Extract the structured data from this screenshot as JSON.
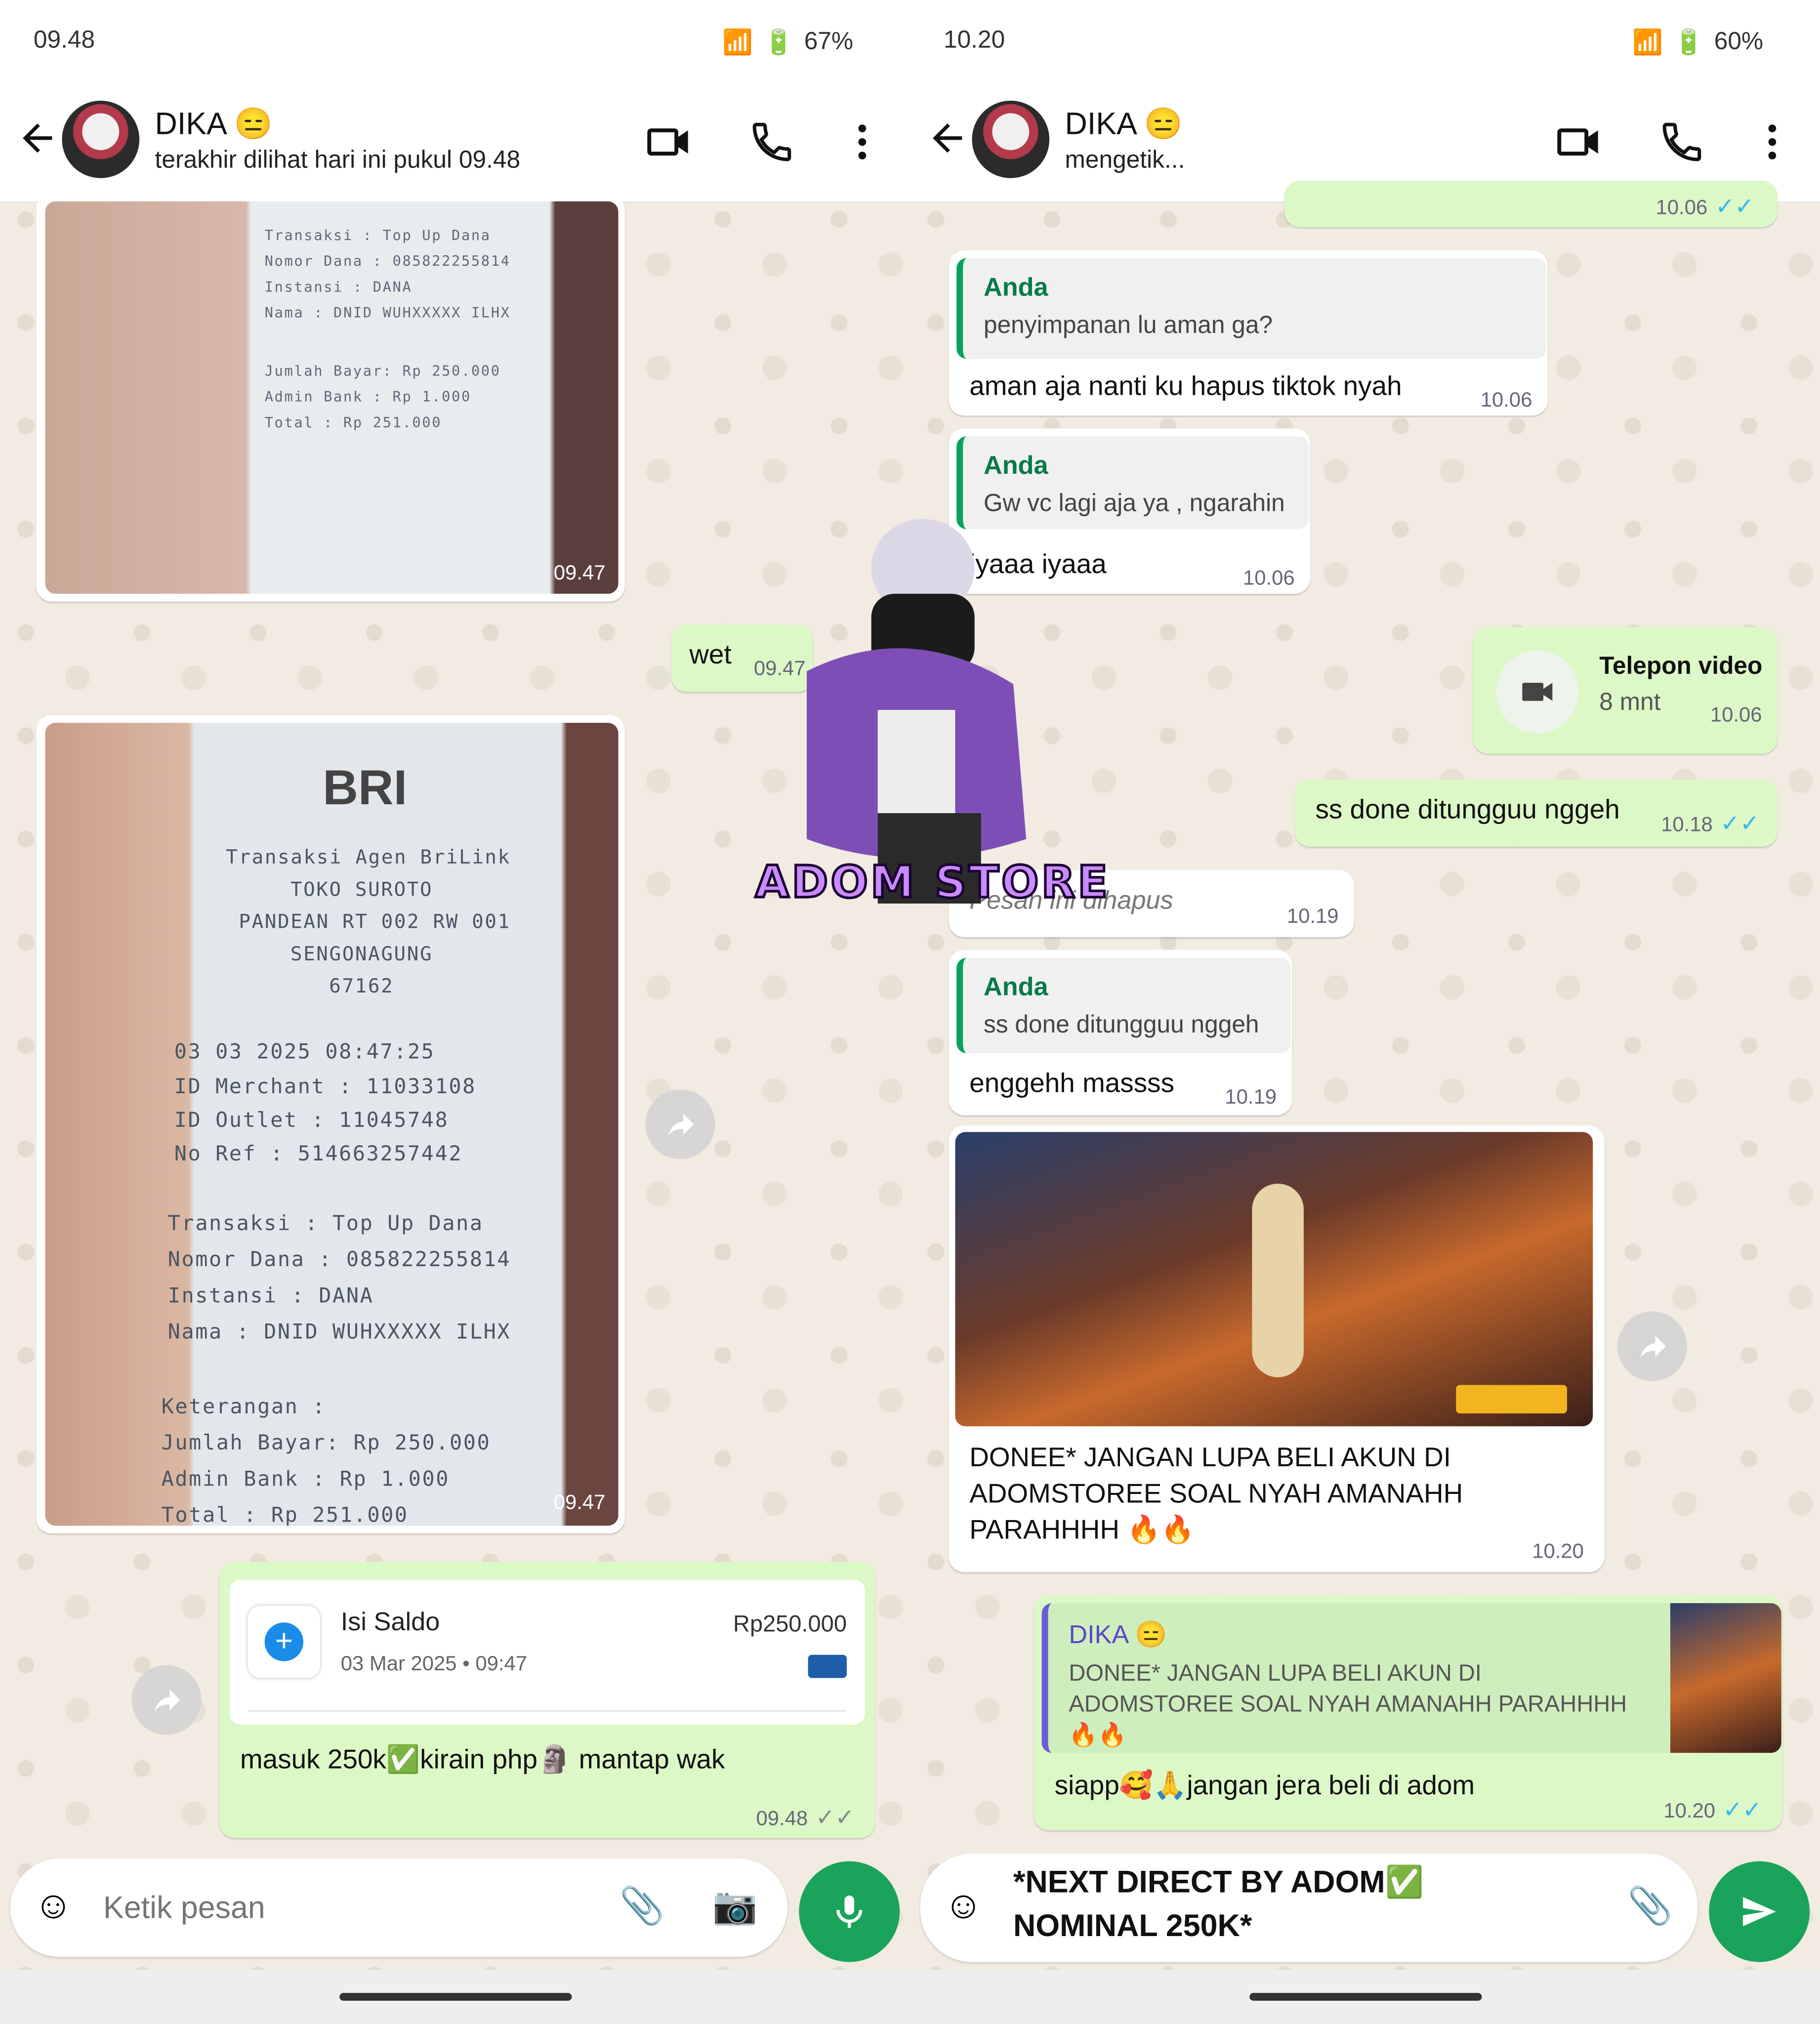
{
  "left": {
    "status_time": "09.48",
    "status_right": "67%",
    "contact_name": "DIKA 😑",
    "last_seen": "terakhir dilihat hari ini pukul 09.48",
    "photo1_time": "09.47",
    "wet_text": "wet",
    "wet_time": "09.47",
    "photo2_time": "09.47",
    "receipt_bank": "BRI",
    "receipt_lines": [
      "Transaksi Agen BriLink",
      "TOKO SUROTO",
      "PANDEAN RT 002 RW 001",
      "SENGONAGUNG",
      "67162",
      "03 03 2025 08:47:25",
      "ID Merchant : 11033108",
      "ID Outlet   : 11045748",
      "No Ref      : 514663257442",
      "Transaksi   : Top Up Dana",
      "Nomor Dana  : 085822255814",
      "Instansi    : DANA",
      "Nama        : DNID WUHXXXXX ILHX",
      "Keterangan  :",
      "Jumlah Bayar: Rp 250.000",
      "Admin Bank  : Rp 1.000",
      "Total       : Rp 251.000"
    ],
    "card_title": "Isi Saldo",
    "card_date": "03 Mar 2025 • 09:47",
    "card_amount": "Rp250.000",
    "last_text": "masuk 250k✅kirain php🗿 mantap wak",
    "last_time": "09.48",
    "input_placeholder": "Ketik pesan"
  },
  "right": {
    "status_time": "10.20",
    "status_right": "60%",
    "contact_name": "DIKA 😑",
    "typing": "mengetik...",
    "top_time": "10.06",
    "q1_author": "Anda",
    "q1_text": "penyimpanan lu aman ga?",
    "m1_text": "aman aja nanti ku hapus tiktok nyah",
    "m1_time": "10.06",
    "q2_author": "Anda",
    "q2_text": "Gw vc lagi aja ya , ngarahin",
    "m2_text": "iyaaa iyaaa",
    "m2_time": "10.06",
    "call_title": "Telepon video",
    "call_duration": "8 mnt",
    "call_time": "10.06",
    "m3_text": "ss done ditungguu nggeh",
    "m3_time": "10.18",
    "deleted_text": "Pesan ini dihapus",
    "deleted_time": "10.19",
    "q3_author": "Anda",
    "q3_text": "ss done ditungguu nggeh",
    "m4_text": "enggehh massss",
    "m4_time": "10.19",
    "img_caption": "DONEE* JANGAN LUPA BELI AKUN DI ADOMSTOREE SOAL NYAH AMANAHH PARAHHHH 🔥🔥",
    "img_time": "10.20",
    "reply_author": "DIKA 😑",
    "reply_quote": "DONEE* JANGAN LUPA BELI AKUN DI ADOMSTOREE SOAL NYAH AMANAHH PARAHHHH 🔥🔥",
    "reply_text": "siapp🥰🙏jangan jera beli di adom",
    "reply_time": "10.20",
    "draft_line1": "*NEXT DIRECT BY ADOM✅",
    "draft_line2": "NOMINAL 250K*"
  },
  "sticker_text": "ADOM STORE",
  "colors": {
    "outgoing": "#dcf8c6",
    "incoming": "#ffffff",
    "accent": "#1aa35a",
    "tick": "#34b7f1"
  }
}
